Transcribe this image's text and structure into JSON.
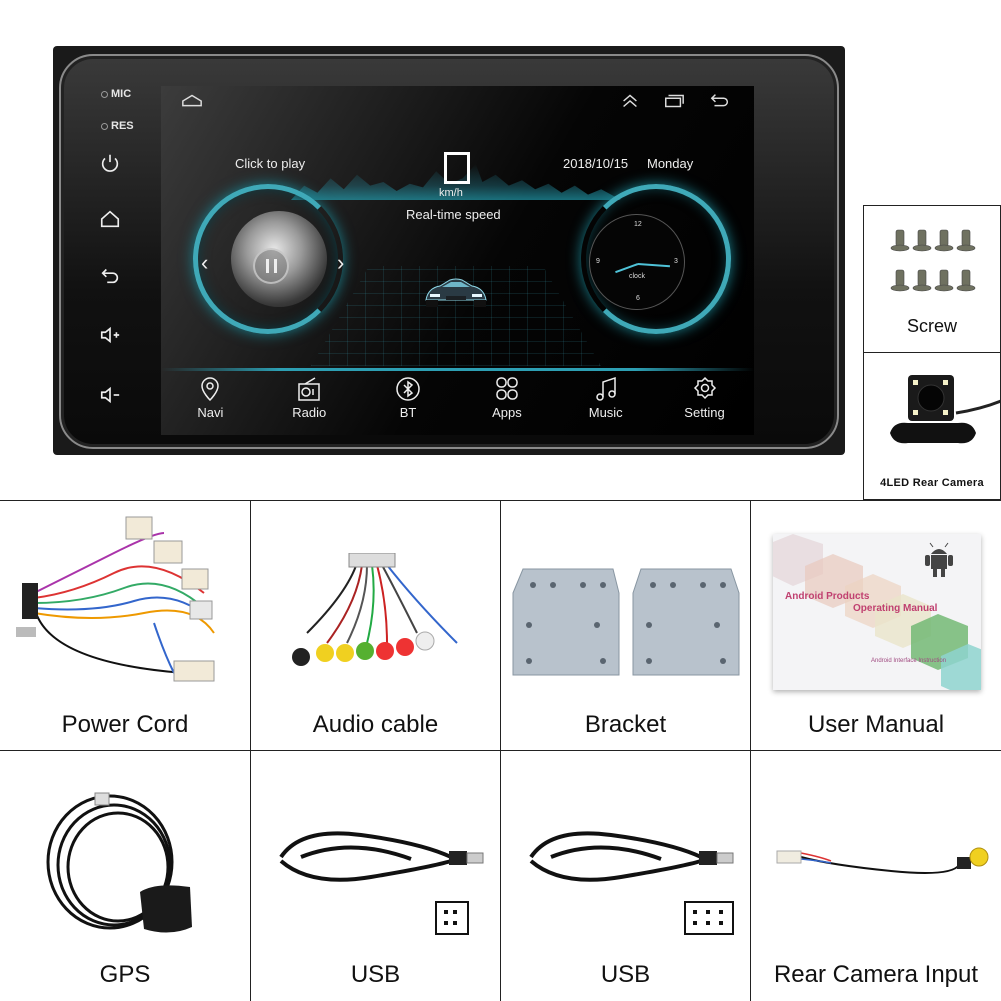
{
  "head_unit": {
    "side_panel": {
      "indicators": [
        {
          "label": "MIC"
        },
        {
          "label": "RES"
        }
      ],
      "buttons": [
        {
          "icon": "power-icon"
        },
        {
          "icon": "home-icon"
        },
        {
          "icon": "back-icon"
        },
        {
          "icon": "volume-up-icon"
        },
        {
          "icon": "volume-down-icon"
        }
      ]
    },
    "screen": {
      "topbar": {
        "left_icon": "home-outline-icon",
        "right_icons": [
          "double-chevron-up-icon",
          "recent-apps-icon",
          "back-arrow-icon"
        ]
      },
      "music_widget": {
        "label": "Click to play",
        "state": "paused"
      },
      "speed_widget": {
        "unit": "km/h",
        "label": "Real-time speed"
      },
      "clock_widget": {
        "date": "2018/10/15",
        "day": "Monday",
        "face_label": "clock",
        "numerals": [
          "12",
          "3",
          "6",
          "9"
        ]
      },
      "dock": [
        {
          "label": "Navi",
          "icon": "location-pin-icon"
        },
        {
          "label": "Radio",
          "icon": "radio-icon"
        },
        {
          "label": "BT",
          "icon": "bluetooth-icon"
        },
        {
          "label": "Apps",
          "icon": "apps-grid-icon"
        },
        {
          "label": "Music",
          "icon": "music-note-icon"
        },
        {
          "label": "Setting",
          "icon": "gear-icon"
        }
      ]
    }
  },
  "accessories": {
    "screw": {
      "label": "Screw",
      "count": 8
    },
    "rear_camera": {
      "label": "4LED Rear Camera"
    },
    "power_cord": {
      "label": "Power Cord"
    },
    "audio_cable": {
      "label": "Audio cable"
    },
    "bracket": {
      "label": "Bracket"
    },
    "user_manual": {
      "label": "User Manual",
      "cover_title_1": "Android Products",
      "cover_title_2": "Operating Manual",
      "cover_subtitle": "Android Interface Instruction"
    },
    "gps": {
      "label": "GPS"
    },
    "usb_1": {
      "label": "USB",
      "pin_icon": "four-pin-connector-icon"
    },
    "usb_2": {
      "label": "USB",
      "pin_icon": "six-pin-connector-icon"
    },
    "rear_camera_input": {
      "label": "Rear Camera Input"
    }
  }
}
